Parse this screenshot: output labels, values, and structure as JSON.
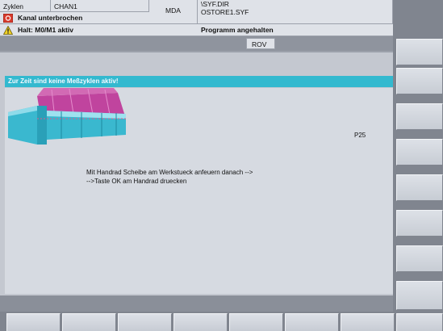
{
  "header": {
    "area": "Zyklen",
    "channel": "CHAN1",
    "mode": "MDA",
    "program_dir": "\\SYF.DIR",
    "program_file": "OSTORE1.SYF"
  },
  "messages": {
    "channel_status": "Kanal unterbrochen",
    "program_status": "Programm angehalten",
    "stop_reason": "Halt: M0/M1 aktiv",
    "rov": "ROV"
  },
  "main": {
    "banner": "Zur Zeit sind keine Meßzyklen aktiv!",
    "parameter": "P25",
    "instruction_line1": "Mit Handrad Scheibe am Werkstueck anfeuern danach -->",
    "instruction_line2": "-->Taste OK am Handrad druecken"
  },
  "softkeys": {
    "vertical": [
      "",
      "",
      "",
      "",
      "",
      "",
      "",
      ""
    ],
    "horizontal": [
      "",
      "",
      "",
      "",
      "",
      "",
      "",
      ""
    ]
  },
  "colors": {
    "banner_bg": "#33b9cf",
    "wheel": "#3ab8cf",
    "grinding_magenta": "#c0449e",
    "alarm_red": "#d83a2c",
    "warning_yellow": "#f2d326"
  }
}
